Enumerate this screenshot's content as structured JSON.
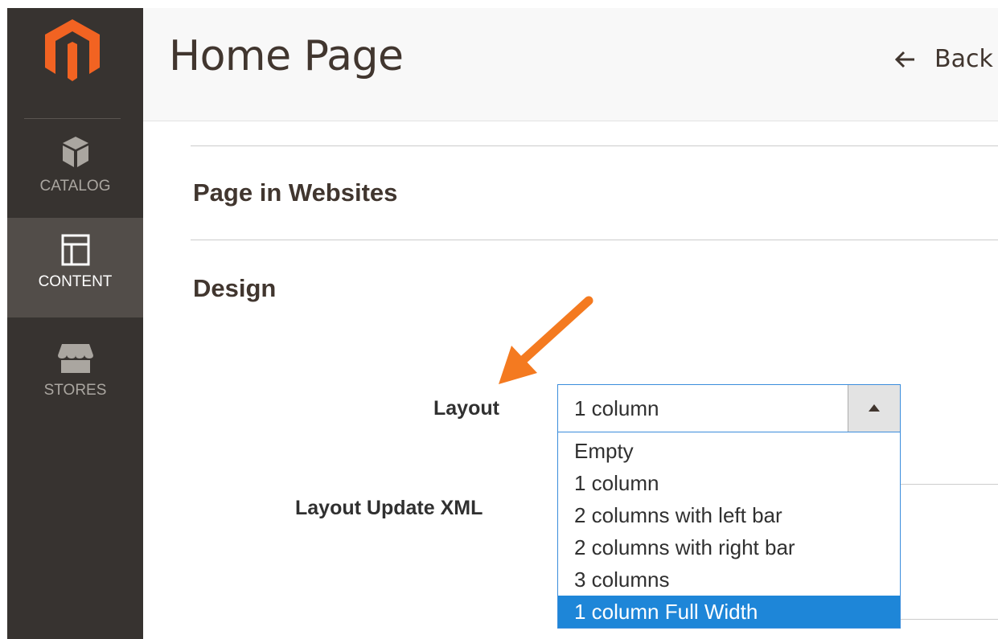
{
  "sidebar": {
    "items": [
      {
        "label": "CATALOG",
        "icon": "catalog-box-icon"
      },
      {
        "label": "CONTENT",
        "icon": "content-layout-icon",
        "active": true
      },
      {
        "label": "STORES",
        "icon": "stores-awning-icon"
      }
    ],
    "logo_icon": "magento-logo-icon"
  },
  "header": {
    "title": "Home Page",
    "back_label": "Back",
    "back_icon": "arrow-left-icon"
  },
  "sections": {
    "websites_title": "Page in Websites",
    "design_title": "Design"
  },
  "design": {
    "layout_label": "Layout",
    "layout_value": "1 column",
    "layout_options": [
      "Empty",
      "1 column",
      "2 columns with left bar",
      "2 columns with right bar",
      "3 columns",
      "1 column Full Width"
    ],
    "highlighted_option": "1 column Full Width",
    "xml_label": "Layout Update XML"
  },
  "colors": {
    "sidebar_bg": "#373330",
    "sidebar_active_bg": "#524d49",
    "logo_orange": "#f26322",
    "arrow_orange": "#f47a20",
    "selection_blue": "#1e86d8",
    "focus_border": "#3b8ddc"
  }
}
